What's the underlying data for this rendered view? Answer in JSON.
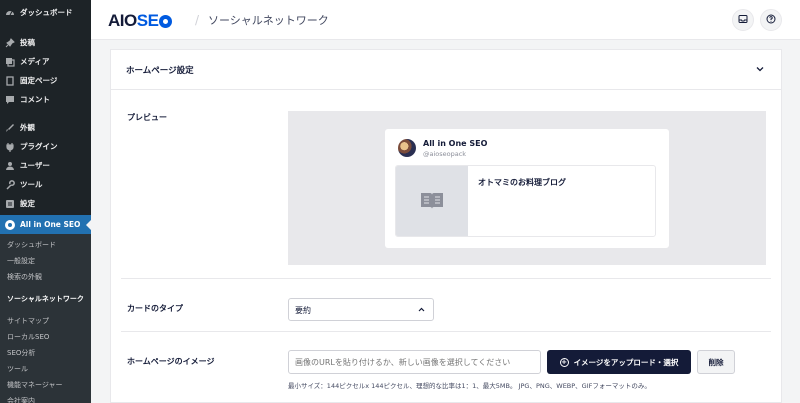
{
  "sidebar": {
    "main_items": [
      {
        "label": "ダッシュボード",
        "icon": "dashboard-icon"
      },
      {
        "label": "投稿",
        "icon": "pin-icon"
      },
      {
        "label": "メディア",
        "icon": "media-icon"
      },
      {
        "label": "固定ページ",
        "icon": "pages-icon"
      },
      {
        "label": "コメント",
        "icon": "comment-icon"
      },
      {
        "label": "外観",
        "icon": "brush-icon"
      },
      {
        "label": "プラグイン",
        "icon": "plugin-icon"
      },
      {
        "label": "ユーザー",
        "icon": "user-icon"
      },
      {
        "label": "ツール",
        "icon": "wrench-icon"
      },
      {
        "label": "設定",
        "icon": "settings-icon"
      },
      {
        "label": "All in One SEO",
        "icon": "aioseo-icon"
      }
    ],
    "submenu": [
      "ダッシュボード",
      "一般設定",
      "検索の外観",
      "ソーシャルネットワーク",
      "サイトマップ",
      "ローカルSEO",
      "SEO分析",
      "ツール",
      "機能マネージャー",
      "会社案内"
    ]
  },
  "header": {
    "logo_aio": "AIO",
    "logo_seo_s": "S",
    "logo_seo_e": "E",
    "separator": "/",
    "title": "ソーシャルネットワーク"
  },
  "card": {
    "title": "ホームページ設定",
    "preview_label": "プレビュー",
    "preview": {
      "account_name": "All in One SEO",
      "handle": "@aioseopack",
      "post_title": "オトマミのお料理ブログ"
    },
    "card_type_label": "カードのタイプ",
    "card_type_value": "要約",
    "image_label": "ホームページのイメージ",
    "image_placeholder": "画像のURLを貼り付けるか、新しい画像を選択してください",
    "upload_label": "イメージをアップロード・選択",
    "delete_label": "削除",
    "help_text": "最小サイズ：144ピクセルx 144ピクセル、理想的な比率は1：1、最大5MB。 JPG、PNG、WEBP、GIFフォーマットのみ。"
  },
  "colors": {
    "sidebar_bg": "#1d2327",
    "active_blue": "#2271b1",
    "brand_blue": "#005ae0",
    "button_dark": "#141b38"
  }
}
